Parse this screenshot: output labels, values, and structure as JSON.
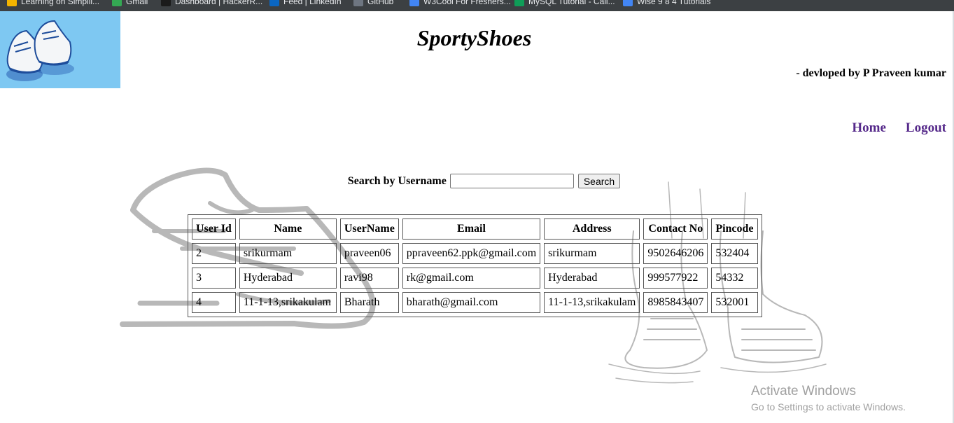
{
  "bookmarks": [
    {
      "label": "Learning on Simplil...",
      "color": "#f4b400"
    },
    {
      "label": "Gmail",
      "color": "#34a853"
    },
    {
      "label": "Dashboard | HackerR...",
      "color": "#1b1b1b"
    },
    {
      "label": "Feed | LinkedIn",
      "color": "#0a66c2"
    },
    {
      "label": "GitHub",
      "color": "#6e7681"
    },
    {
      "label": "W3Cool For Freshers...",
      "color": "#4285f4"
    },
    {
      "label": "MySQL Tutorial - Call...",
      "color": "#0f9d58"
    },
    {
      "label": "Wise 9 8 4 Tutorials",
      "color": "#4285f4"
    }
  ],
  "site": {
    "title": "SportyShoes",
    "credit": "- devloped by P Praveen kumar"
  },
  "nav": {
    "home": "Home",
    "logout": "Logout"
  },
  "search": {
    "label": "Search by Username",
    "value": "",
    "button": "Search"
  },
  "table": {
    "headers": [
      "User Id",
      "Name",
      "UserName",
      "Email",
      "Address",
      "Contact No",
      "Pincode"
    ],
    "rows": [
      [
        "2",
        "srikurmam",
        "praveen06",
        "ppraveen62.ppk@gmail.com",
        "srikurmam",
        "9502646206",
        "532404"
      ],
      [
        "3",
        "Hyderabad",
        "ravi98",
        "rk@gmail.com",
        "Hyderabad",
        "999577922",
        "54332"
      ],
      [
        "4",
        "11-1-13,srikakulam",
        "Bharath",
        "bharath@gmail.com",
        "11-1-13,srikakulam",
        "8985843407",
        "532001"
      ]
    ]
  },
  "watermark": {
    "title": "Activate Windows",
    "subtitle": "Go to Settings to activate Windows."
  },
  "colors": {
    "nav_link": "#55298a",
    "logo_bg": "#7ec8f2",
    "bookmarks_bg": "#3c4043"
  }
}
